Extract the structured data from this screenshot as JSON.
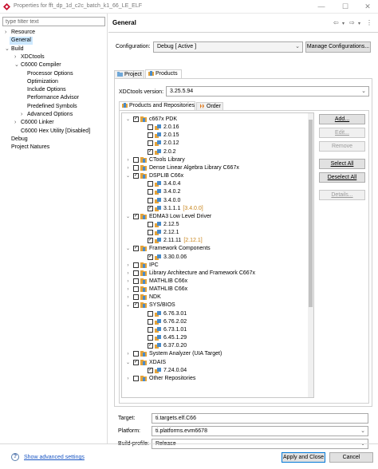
{
  "window": {
    "title": "Properties for fft_dp_1d_c2c_batch_k1_66_LE_ELF",
    "controls": {
      "minimize": "—",
      "maximize": "☐",
      "close": "✕"
    }
  },
  "filter": {
    "placeholder": "type filter text"
  },
  "nav": [
    {
      "label": "Resource",
      "depth": 0,
      "arrow": "›"
    },
    {
      "label": "General",
      "depth": 0,
      "arrow": "",
      "selected": true
    },
    {
      "label": "Build",
      "depth": 0,
      "arrow": "⌄"
    },
    {
      "label": "XDCtools",
      "depth": 1,
      "arrow": "›"
    },
    {
      "label": "C6000 Compiler",
      "depth": 1,
      "arrow": "⌄"
    },
    {
      "label": "Processor Options",
      "depth": 2,
      "arrow": ""
    },
    {
      "label": "Optimization",
      "depth": 2,
      "arrow": ""
    },
    {
      "label": "Include Options",
      "depth": 2,
      "arrow": ""
    },
    {
      "label": "Performance Advisor",
      "depth": 2,
      "arrow": ""
    },
    {
      "label": "Predefined Symbols",
      "depth": 2,
      "arrow": ""
    },
    {
      "label": "Advanced Options",
      "depth": 2,
      "arrow": "›"
    },
    {
      "label": "C6000 Linker",
      "depth": 1,
      "arrow": "›"
    },
    {
      "label": "C6000 Hex Utility  [Disabled]",
      "depth": 1,
      "arrow": ""
    },
    {
      "label": "Debug",
      "depth": 0,
      "arrow": ""
    },
    {
      "label": "Project Natures",
      "depth": 0,
      "arrow": ""
    }
  ],
  "page": {
    "title": "General",
    "config_label": "Configuration:",
    "config_value": "Debug  [ Active ]",
    "manage_button": "Manage Configurations...",
    "tabs": [
      "Project",
      "Products"
    ],
    "xdc_label": "XDCtools version:",
    "xdc_value": "3.25.5.94",
    "inner_tabs": [
      "Products and Repositories",
      "Order"
    ],
    "side_buttons": {
      "add": "Add...",
      "edit": "Edit...",
      "remove": "Remove",
      "select_all": "Select All",
      "deselect_all": "Deselect All",
      "details": "Details..."
    },
    "target_label": "Target:",
    "target_value": "ti.targets.elf.C66",
    "platform_label": "Platform:",
    "platform_value": "ti.platforms.evm6678",
    "profile_label": "Build-profile:",
    "profile_value": "Release"
  },
  "tree": [
    {
      "level": 0,
      "tw": "⌄",
      "checked": true,
      "icon": "folder",
      "label": "c667x PDK"
    },
    {
      "level": 1,
      "tw": "",
      "checked": false,
      "icon": "pkg",
      "label": "2.0.16"
    },
    {
      "level": 1,
      "tw": "",
      "checked": false,
      "icon": "pkg",
      "label": "2.0.15"
    },
    {
      "level": 1,
      "tw": "",
      "checked": false,
      "icon": "pkg",
      "label": "2.0.12"
    },
    {
      "level": 1,
      "tw": "",
      "checked": true,
      "icon": "pkg",
      "label": "2.0.2"
    },
    {
      "level": 0,
      "tw": "›",
      "checked": false,
      "icon": "folder",
      "label": "CTools Library"
    },
    {
      "level": 0,
      "tw": "›",
      "checked": false,
      "icon": "folder",
      "label": "Dense Linear Algebra Library C667x"
    },
    {
      "level": 0,
      "tw": "⌄",
      "checked": true,
      "icon": "folder",
      "label": "DSPLIB C66x"
    },
    {
      "level": 1,
      "tw": "",
      "checked": false,
      "icon": "pkg",
      "label": "3.4.0.4"
    },
    {
      "level": 1,
      "tw": "",
      "checked": false,
      "icon": "pkg",
      "label": "3.4.0.2"
    },
    {
      "level": 1,
      "tw": "",
      "checked": false,
      "icon": "pkg",
      "label": "3.4.0.0"
    },
    {
      "level": 1,
      "tw": "",
      "checked": true,
      "icon": "pkg",
      "label": "3.1.1.1",
      "dep": "[3.4.0.0]"
    },
    {
      "level": 0,
      "tw": "⌄",
      "checked": true,
      "icon": "folder",
      "label": "EDMA3 Low Level Driver"
    },
    {
      "level": 1,
      "tw": "",
      "checked": false,
      "icon": "pkg",
      "label": "2.12.5"
    },
    {
      "level": 1,
      "tw": "",
      "checked": false,
      "icon": "pkg",
      "label": "2.12.1"
    },
    {
      "level": 1,
      "tw": "",
      "checked": true,
      "icon": "pkg",
      "label": "2.11.11",
      "dep": "[2.12.1]"
    },
    {
      "level": 0,
      "tw": "⌄",
      "checked": true,
      "icon": "folder",
      "label": "Framework Components"
    },
    {
      "level": 1,
      "tw": "",
      "checked": true,
      "icon": "pkg",
      "label": "3.30.0.06"
    },
    {
      "level": 0,
      "tw": "›",
      "checked": false,
      "icon": "folder",
      "label": "IPC"
    },
    {
      "level": 0,
      "tw": "›",
      "checked": false,
      "icon": "folder",
      "label": "Library Architecture and Framework C667x"
    },
    {
      "level": 0,
      "tw": "›",
      "checked": false,
      "icon": "folder",
      "label": "MATHLIB C66x"
    },
    {
      "level": 0,
      "tw": "›",
      "checked": false,
      "icon": "folder",
      "label": "MATHLIB C66x"
    },
    {
      "level": 0,
      "tw": "›",
      "checked": false,
      "icon": "folder",
      "label": "NDK"
    },
    {
      "level": 0,
      "tw": "⌄",
      "checked": true,
      "icon": "folder",
      "label": "SYS/BIOS"
    },
    {
      "level": 1,
      "tw": "",
      "checked": false,
      "icon": "pkg",
      "label": "6.76.3.01"
    },
    {
      "level": 1,
      "tw": "",
      "checked": false,
      "icon": "pkg",
      "label": "6.76.2.02"
    },
    {
      "level": 1,
      "tw": "",
      "checked": false,
      "icon": "pkg",
      "label": "6.73.1.01"
    },
    {
      "level": 1,
      "tw": "",
      "checked": false,
      "icon": "pkg",
      "label": "6.45.1.29"
    },
    {
      "level": 1,
      "tw": "",
      "checked": true,
      "icon": "pkg",
      "label": "6.37.0.20"
    },
    {
      "level": 0,
      "tw": "›",
      "checked": false,
      "icon": "folder",
      "label": "System Analyzer (UIA Target)"
    },
    {
      "level": 0,
      "tw": "⌄",
      "checked": true,
      "icon": "folder",
      "label": "XDAIS"
    },
    {
      "level": 1,
      "tw": "",
      "checked": true,
      "icon": "pkg",
      "label": "7.24.0.04"
    },
    {
      "level": 0,
      "tw": "›",
      "checked": false,
      "icon": "folder",
      "label": "Other Repositories"
    }
  ],
  "footer": {
    "help_icon": "?",
    "show_advanced": "Show advanced settings",
    "apply_close": "Apply and Close",
    "cancel": "Cancel"
  },
  "colors": {
    "selected_bg": "#cce8ff",
    "link": "#1a56c4",
    "dep_version": "#c8841a",
    "primary_border": "#0078d7"
  }
}
